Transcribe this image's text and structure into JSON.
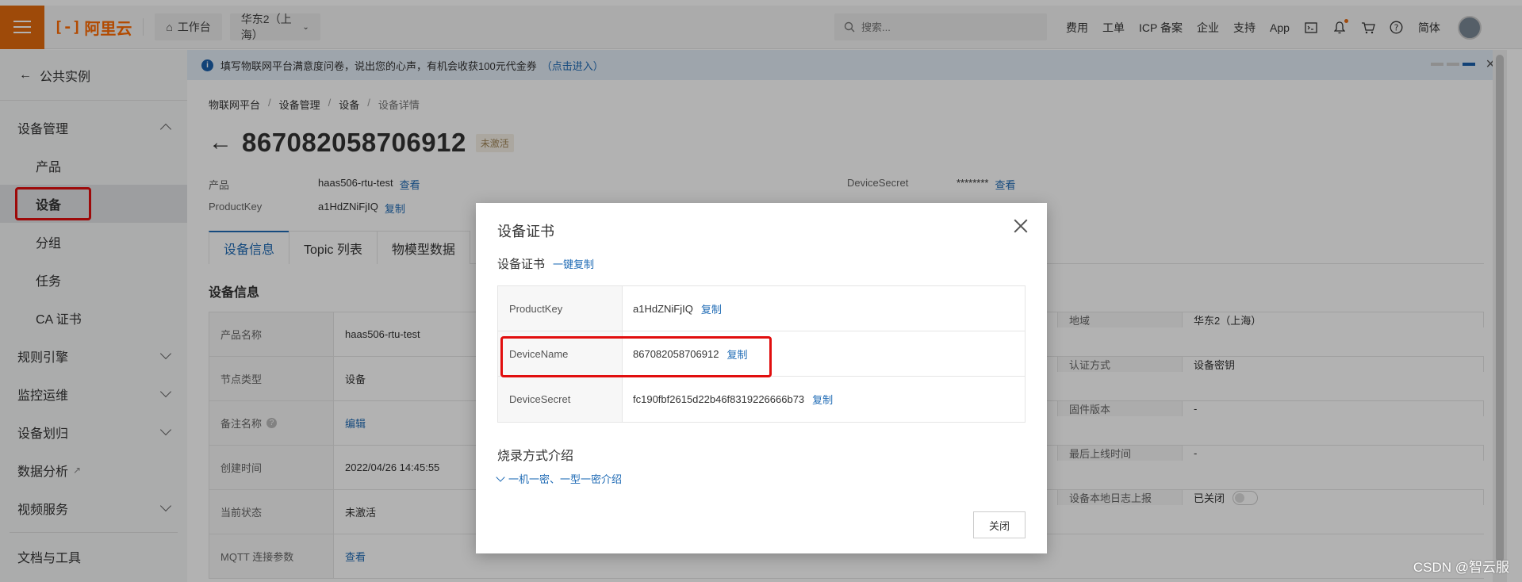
{
  "topbar": {
    "logo_text": "阿里云",
    "workbench": "工作台",
    "region": "华东2（上海）",
    "search_placeholder": "搜索...",
    "links": [
      "费用",
      "工单",
      "ICP 备案",
      "企业",
      "支持",
      "App"
    ],
    "lang": "简体"
  },
  "sidebar": {
    "back": "公共实例",
    "device_mgmt": "设备管理",
    "items": [
      "产品",
      "设备",
      "分组",
      "任务",
      "CA 证书"
    ],
    "groups": [
      "规则引擎",
      "监控运维",
      "设备划归",
      "数据分析",
      "视频服务"
    ],
    "docs": "文档与工具"
  },
  "notice": {
    "text": "填写物联网平台满意度问卷，说出您的心声，有机会收获100元代金券",
    "link": "（点击进入）"
  },
  "breadcrumb": [
    "物联网平台",
    "设备管理",
    "设备",
    "设备详情"
  ],
  "device": {
    "name": "867082058706912",
    "status": "未激活",
    "product_label": "产品",
    "product_value": "haas506-rtu-test",
    "product_link": "查看",
    "productkey_label": "ProductKey",
    "productkey_value": "a1HdZNiFjIQ",
    "productkey_link": "复制",
    "secret_label": "DeviceSecret",
    "secret_value": "********",
    "secret_link": "查看"
  },
  "tabs": [
    "设备信息",
    "Topic 列表",
    "物模型数据"
  ],
  "info": {
    "title": "设备信息",
    "left": [
      {
        "k": "产品名称",
        "v": "haas506-rtu-test"
      },
      {
        "k": "节点类型",
        "v": "设备"
      },
      {
        "k": "备注名称",
        "v": "编辑"
      },
      {
        "k": "创建时间",
        "v": "2022/04/26 14:45:55"
      },
      {
        "k": "当前状态",
        "v": "未激活"
      },
      {
        "k": "MQTT 连接参数",
        "v": "查看"
      }
    ],
    "right": [
      {
        "k": "地域",
        "v": "华东2（上海）"
      },
      {
        "k": "认证方式",
        "v": "设备密钥"
      },
      {
        "k": "固件版本",
        "v": "-"
      },
      {
        "k": "最后上线时间",
        "v": "-"
      },
      {
        "k": "设备本地日志上报",
        "v": "已关闭"
      }
    ]
  },
  "modal": {
    "title": "设备证书",
    "section": "设备证书",
    "copy_all": "一键复制",
    "rows": [
      {
        "k": "ProductKey",
        "v": "a1HdZNiFjIQ",
        "action": "复制"
      },
      {
        "k": "DeviceName",
        "v": "867082058706912",
        "action": "复制"
      },
      {
        "k": "DeviceSecret",
        "v": "fc190fbf2615d22b46f8319226666b73",
        "action": "复制"
      }
    ],
    "burn_title": "烧录方式介绍",
    "burn_link": "一机一密、一型一密介绍",
    "close_button": "关闭"
  },
  "watermark": "CSDN @智云服"
}
